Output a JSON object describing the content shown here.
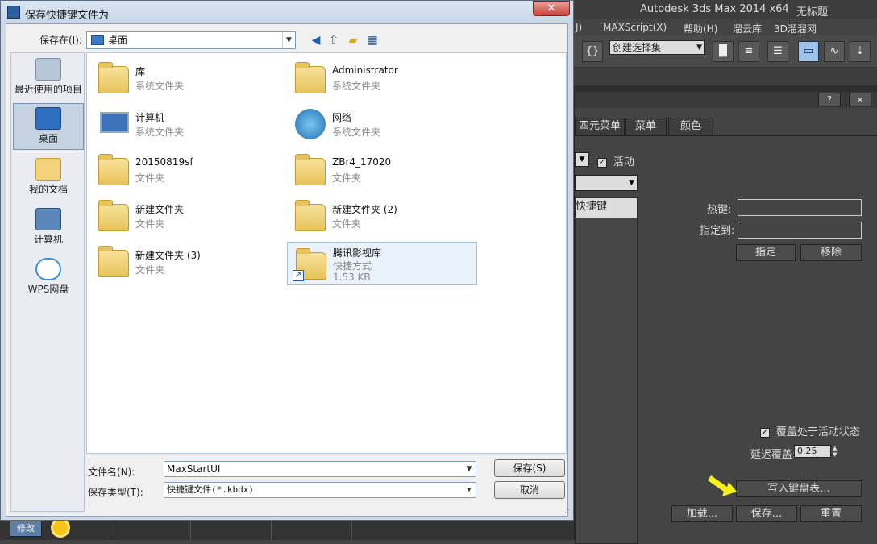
{
  "app": {
    "title": "Autodesk 3ds Max  2014 x64",
    "document": "无标题",
    "menu": [
      "J)",
      "MAXScript(X)",
      "帮助(H)",
      "溜云库",
      "3D溜溜网"
    ],
    "selection_set_placeholder": "创建选择集"
  },
  "customize": {
    "help_btn": "?",
    "close_btn": "×",
    "tabs": [
      "四元菜单",
      "菜单",
      "颜色"
    ],
    "active_label": "活动",
    "list_header": "快捷键",
    "hotkey_label": "热键:",
    "assigned_to_label": "指定到:",
    "assign_btn": "指定",
    "remove_btn": "移除",
    "override_label": "覆盖处于活动状态",
    "delay_label": "延迟覆盖:",
    "delay_value": "0.25",
    "write_btn": "写入键盘表...",
    "load_btn": "加载...",
    "save_btn": "保存...",
    "reset_btn": "重置"
  },
  "dialog": {
    "title": "保存快捷键文件为",
    "close": "✕",
    "save_in_label": "保存在(I):",
    "save_in_value": "桌面",
    "places": [
      "最近使用的项目",
      "桌面",
      "我的文档",
      "计算机",
      "WPS网盘"
    ],
    "files": [
      {
        "name": "库",
        "type": "系统文件夹"
      },
      {
        "name": "Administrator",
        "type": "系统文件夹"
      },
      {
        "name": "计算机",
        "type": "系统文件夹"
      },
      {
        "name": "网络",
        "type": "系统文件夹"
      },
      {
        "name": "20150819sf",
        "type": "文件夹"
      },
      {
        "name": "ZBr4_17020",
        "type": "文件夹"
      },
      {
        "name": "新建文件夹",
        "type": "文件夹"
      },
      {
        "name": "新建文件夹 (2)",
        "type": "文件夹"
      },
      {
        "name": "新建文件夹 (3)",
        "type": "文件夹"
      },
      {
        "name": "腾讯影视库",
        "type": "快捷方式",
        "size": "1.53 KB"
      }
    ],
    "filename_label": "文件名(N):",
    "filename_value": "MaxStartUI",
    "filetype_label": "保存类型(T):",
    "filetype_value": "快捷键文件(*.kbdx)",
    "save_btn": "保存(S)",
    "cancel_btn": "取消"
  },
  "viewport": {
    "modify_label": "修改"
  },
  "colors": {
    "accent_arrow": "#f5ef1a",
    "dialog_frame": "#cfd8e3",
    "max_bg": "#444444"
  }
}
